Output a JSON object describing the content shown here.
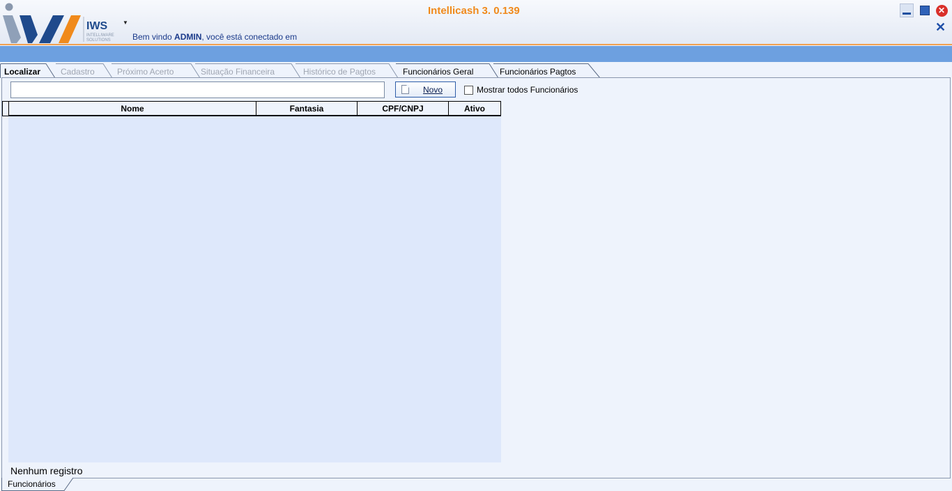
{
  "header": {
    "app_title": "Intellicash 3. 0.139",
    "welcome_prefix": "Bem vindo ",
    "welcome_user": "ADMIN",
    "welcome_suffix": ", você está conectado em",
    "logo_text": "IWS",
    "logo_sub1": "INTELLIWARE",
    "logo_sub2": "SOLUTIONS"
  },
  "window_controls": {
    "close_glyph": "✕"
  },
  "tabs": [
    {
      "label": "Localizar",
      "state": "active"
    },
    {
      "label": "Cadastro",
      "state": "disabled"
    },
    {
      "label": "Próximo Acerto",
      "state": "disabled"
    },
    {
      "label": "Situação Financeira",
      "state": "disabled"
    },
    {
      "label": "Histórico de Pagtos",
      "state": "disabled"
    },
    {
      "label": "Funcionários Geral",
      "state": "enabled"
    },
    {
      "label": "Funcionários Pagtos",
      "state": "enabled"
    }
  ],
  "search": {
    "value": "",
    "new_button_label": "Novo",
    "show_all_label": "Mostrar todos Funcionários",
    "show_all_checked": false
  },
  "grid": {
    "columns": [
      "Nome",
      "Fantasia",
      "CPF/CNPJ",
      "Ativo"
    ],
    "rows": []
  },
  "status_text": "Nenhum registro",
  "bottom_tab_label": "Funcionários",
  "colors": {
    "title_orange": "#f08a1c",
    "band_blue": "#6da0e0",
    "grid_bg": "#dee8fb"
  }
}
